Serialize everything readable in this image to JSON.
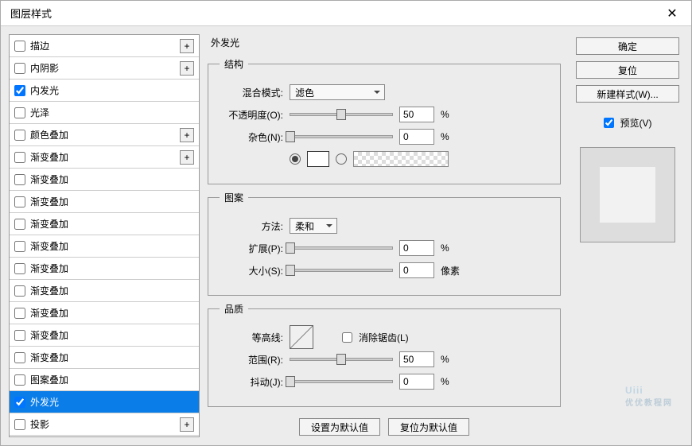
{
  "window": {
    "title": "图层样式"
  },
  "effects": [
    {
      "label": "描边",
      "checked": false,
      "plus": true
    },
    {
      "label": "内阴影",
      "checked": false,
      "plus": true
    },
    {
      "label": "内发光",
      "checked": true,
      "plus": false
    },
    {
      "label": "光泽",
      "checked": false,
      "plus": false
    },
    {
      "label": "颜色叠加",
      "checked": false,
      "plus": true
    },
    {
      "label": "渐变叠加",
      "checked": false,
      "plus": true
    },
    {
      "label": "渐变叠加",
      "checked": false,
      "plus": false
    },
    {
      "label": "渐变叠加",
      "checked": false,
      "plus": false
    },
    {
      "label": "渐变叠加",
      "checked": false,
      "plus": false
    },
    {
      "label": "渐变叠加",
      "checked": false,
      "plus": false
    },
    {
      "label": "渐变叠加",
      "checked": false,
      "plus": false
    },
    {
      "label": "渐变叠加",
      "checked": false,
      "plus": false
    },
    {
      "label": "渐变叠加",
      "checked": false,
      "plus": false
    },
    {
      "label": "渐变叠加",
      "checked": false,
      "plus": false
    },
    {
      "label": "渐变叠加",
      "checked": false,
      "plus": false
    },
    {
      "label": "图案叠加",
      "checked": false,
      "plus": false
    },
    {
      "label": "外发光",
      "checked": true,
      "plus": false,
      "selected": true
    },
    {
      "label": "投影",
      "checked": false,
      "plus": true
    }
  ],
  "panel": {
    "title": "外发光",
    "structure": {
      "legend": "结构",
      "blend_label": "混合模式:",
      "blend_value": "滤色",
      "opacity_label": "不透明度(O):",
      "opacity_value": "50",
      "opacity_unit": "%",
      "noise_label": "杂色(N):",
      "noise_value": "0",
      "noise_unit": "%"
    },
    "element": {
      "legend": "图案",
      "method_label": "方法:",
      "method_value": "柔和",
      "spread_label": "扩展(P):",
      "spread_value": "0",
      "spread_unit": "%",
      "size_label": "大小(S):",
      "size_value": "0",
      "size_unit": "像素"
    },
    "quality": {
      "legend": "品质",
      "contour_label": "等高线:",
      "antialias_label": "消除锯齿(L)",
      "range_label": "范围(R):",
      "range_value": "50",
      "range_unit": "%",
      "jitter_label": "抖动(J):",
      "jitter_value": "0",
      "jitter_unit": "%"
    },
    "buttons": {
      "default": "设置为默认值",
      "reset": "复位为默认值"
    }
  },
  "right": {
    "ok": "确定",
    "cancel": "复位",
    "newstyle": "新建样式(W)...",
    "preview_label": "预览(V)"
  },
  "watermark": {
    "main": "Uiii",
    "sub": "优优教程网"
  }
}
